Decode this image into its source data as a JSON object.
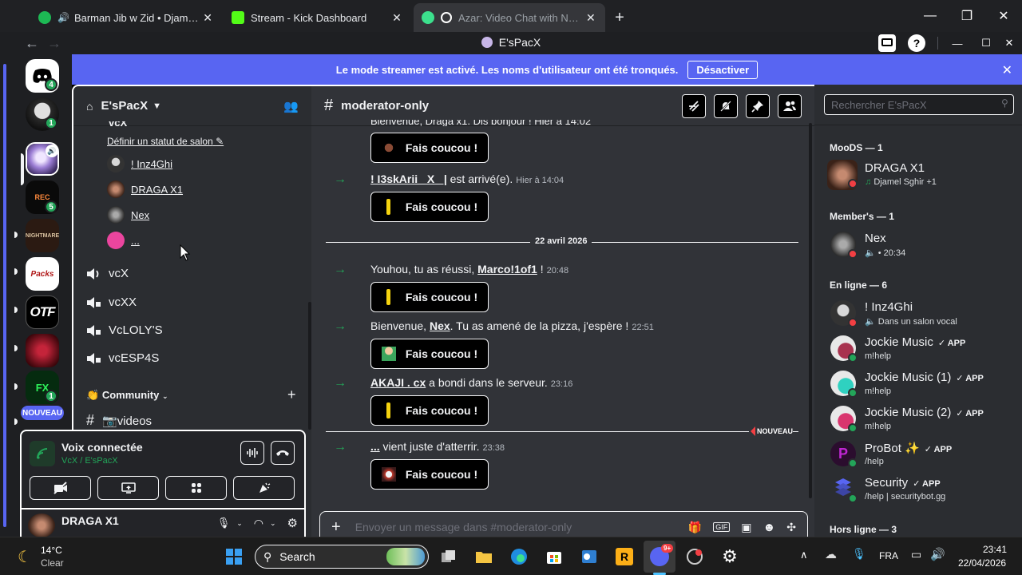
{
  "browser": {
    "tabs": [
      {
        "title": "Barman Jib w Zid • Djamel Sghi",
        "active": false
      },
      {
        "title": "Stream - Kick Dashboard",
        "active": false
      },
      {
        "title": "Azar: Video Chat with New Pe",
        "active": true
      }
    ]
  },
  "app": {
    "window_title": "E'sPacX"
  },
  "banner": {
    "text": "Le mode streamer est activé. Les noms d'utilisateur ont été tronqués.",
    "button": "Désactiver"
  },
  "servers": {
    "badges": [
      "4",
      "1",
      "5",
      "1"
    ],
    "nouveau": "NOUVEAU",
    "labels": [
      "REC",
      "NIGHTMARE",
      "Packs",
      "OTF",
      "FX"
    ]
  },
  "sidebar": {
    "server_name": "E'sPacX",
    "partial_channel": "vcX",
    "status_link": "Définir un statut de salon",
    "voice_members": [
      "! Inz4Ghi",
      "DRAGA X1",
      "Nex",
      "..."
    ],
    "voice_channels": [
      "vcX",
      "vcXX",
      "VcLOLY'S",
      "vcESP4S"
    ],
    "category": "Community",
    "text_channel": "📷videos"
  },
  "voice_panel": {
    "status": "Voix connectée",
    "location": "VcX / E'sPacX"
  },
  "user_panel": {
    "username": "DRAGA X1"
  },
  "chat": {
    "channel": "moderator-only",
    "top_partial": "Bienvenue, Draga x1. Dis bonjour ! Hier à 14:02",
    "wave_label": "Fais coucou !",
    "messages": [
      {
        "pre": "",
        "user": "! I3skArii _X_ |",
        "post": " est arrivé(e).",
        "time": "Hier à 14:04"
      },
      {
        "pre": "Youhou, tu as réussi, ",
        "user": "Marco!1of1",
        "post": " !",
        "time": "20:48"
      },
      {
        "pre": "Bienvenue, ",
        "user": "Nex",
        "post": ". Tu as amené de la pizza, j'espère !",
        "time": "22:51"
      },
      {
        "pre": "",
        "user": "AKAJI . cx",
        "post": " a bondi dans le serveur.",
        "time": "23:16"
      },
      {
        "pre": "",
        "user": "...",
        "post": " vient juste d'atterrir.",
        "time": "23:38"
      }
    ],
    "date_divider": "22 avril 2026",
    "new_label": "NOUVEAU",
    "composer_placeholder": "Envoyer un message dans #moderator-only"
  },
  "members": {
    "search_placeholder": "Rechercher E'sPacX",
    "groups": [
      {
        "header": "MooDS — 1",
        "items": [
          {
            "name": "DRAGA X1",
            "sub": "Djamel Sghir +1",
            "app": ""
          }
        ]
      },
      {
        "header": "Member's — 1",
        "items": [
          {
            "name": "Nex",
            "sub": "• 20:34",
            "app": ""
          }
        ]
      },
      {
        "header": "En ligne — 6",
        "items": [
          {
            "name": "! Inz4Ghi",
            "sub": "Dans un salon vocal",
            "app": ""
          },
          {
            "name": "Jockie Music",
            "sub": "m!help",
            "app": "✓ APP"
          },
          {
            "name": "Jockie Music (1)",
            "sub": "m!help",
            "app": "✓ APP"
          },
          {
            "name": "Jockie Music (2)",
            "sub": "m!help",
            "app": "✓ APP"
          },
          {
            "name": "ProBot ✨",
            "sub": "/help",
            "app": "✓ APP"
          },
          {
            "name": "Security",
            "sub": "/help | securitybot.gg",
            "app": "✓ APP"
          }
        ]
      },
      {
        "header": "Hors ligne — 3",
        "items": []
      }
    ]
  },
  "taskbar": {
    "weather_temp": "14°C",
    "weather_desc": "Clear",
    "search_label": "Search",
    "lang": "FRA",
    "time": "23:41",
    "date": "22/04/2026",
    "discord_badge": "9+"
  },
  "colors": {
    "accent": "#5865f2",
    "online": "#23a559",
    "dnd": "#f23f43",
    "bg_chat": "#313338"
  }
}
